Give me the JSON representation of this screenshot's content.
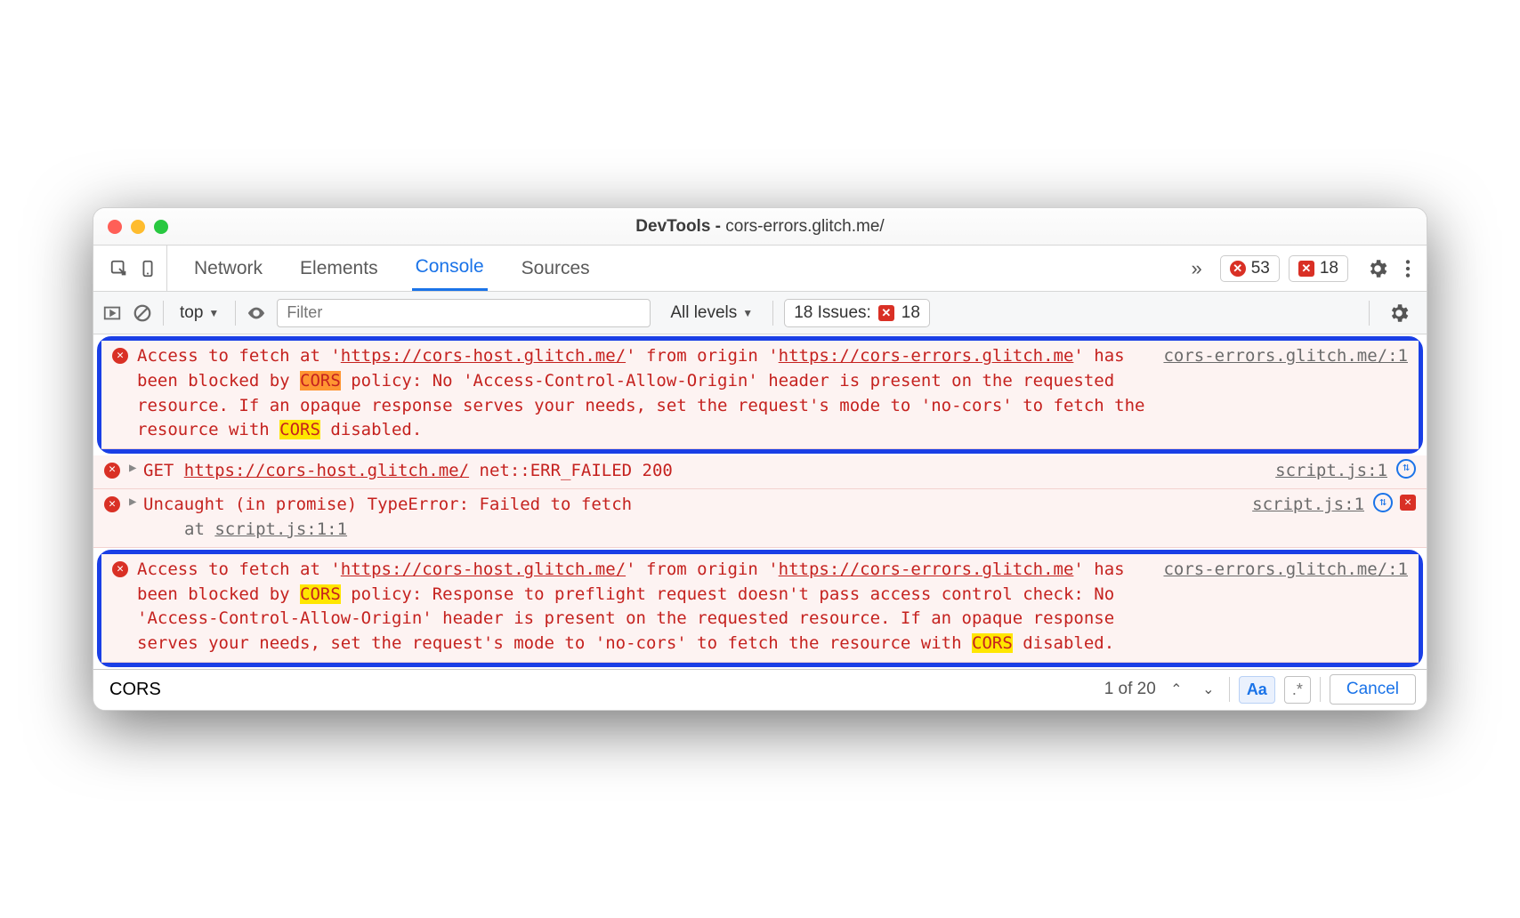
{
  "title": {
    "app": "DevTools",
    "sep": " - ",
    "path": "cors-errors.glitch.me/"
  },
  "tabs": [
    "Network",
    "Elements",
    "Console",
    "Sources"
  ],
  "active_tab": "Console",
  "counters": {
    "errors": "53",
    "messages": "18"
  },
  "subbar": {
    "context": "top",
    "filter_placeholder": "Filter",
    "levels": "All levels",
    "issues_label": "18 Issues:",
    "issues_count": "18"
  },
  "rows": [
    {
      "type": "highlight",
      "parts": [
        {
          "t": "Access to fetch at '"
        },
        {
          "t": "https://cors-host.glitch.me/",
          "u": true
        },
        {
          "t": "' from origin '"
        },
        {
          "t": "https://cors-errors.glitch.me",
          "u": true
        },
        {
          "t": "' has been blocked by "
        },
        {
          "t": "CORS",
          "hi": "or"
        },
        {
          "t": " policy: No 'Access-Control-Allow-Origin' header is present on the requested resource. If an opaque response serves your needs, set the request's mode to 'no-cors' to fetch the resource with "
        },
        {
          "t": "CORS",
          "hi": "ye"
        },
        {
          "t": " disabled."
        }
      ],
      "src": "cors-errors.glitch.me/:1"
    },
    {
      "type": "net",
      "parts": [
        {
          "t": "GET "
        },
        {
          "t": "https://cors-host.glitch.me/",
          "u": true
        },
        {
          "t": " net::ERR_FAILED 200"
        }
      ],
      "src": "script.js:1",
      "sync": true
    },
    {
      "type": "err",
      "parts": [
        {
          "t": "Uncaught (in promise) TypeError: Failed to fetch"
        }
      ],
      "stack": {
        "at": "at ",
        "loc": "script.js:1:1"
      },
      "src": "script.js:1",
      "sync": true,
      "flag": true
    },
    {
      "type": "highlight",
      "parts": [
        {
          "t": "Access to fetch at '"
        },
        {
          "t": "https://cors-host.glitch.me/",
          "u": true
        },
        {
          "t": "' from origin '"
        },
        {
          "t": "https://cors-errors.glitch.me",
          "u": true
        },
        {
          "t": "' has been blocked by "
        },
        {
          "t": "CORS",
          "hi": "ye"
        },
        {
          "t": " policy: Response to preflight request doesn't pass access control check: No 'Access-Control-Allow-Origin' header is present on the requested resource. If an opaque response serves your needs, set the request's mode to 'no-cors' to fetch the resource with "
        },
        {
          "t": "CORS",
          "hi": "ye"
        },
        {
          "t": " disabled."
        }
      ],
      "src": "cors-errors.glitch.me/:1"
    }
  ],
  "search": {
    "term": "CORS",
    "count": "1 of 20",
    "cancel": "Cancel",
    "aa": "Aa",
    "rx": ".*"
  }
}
